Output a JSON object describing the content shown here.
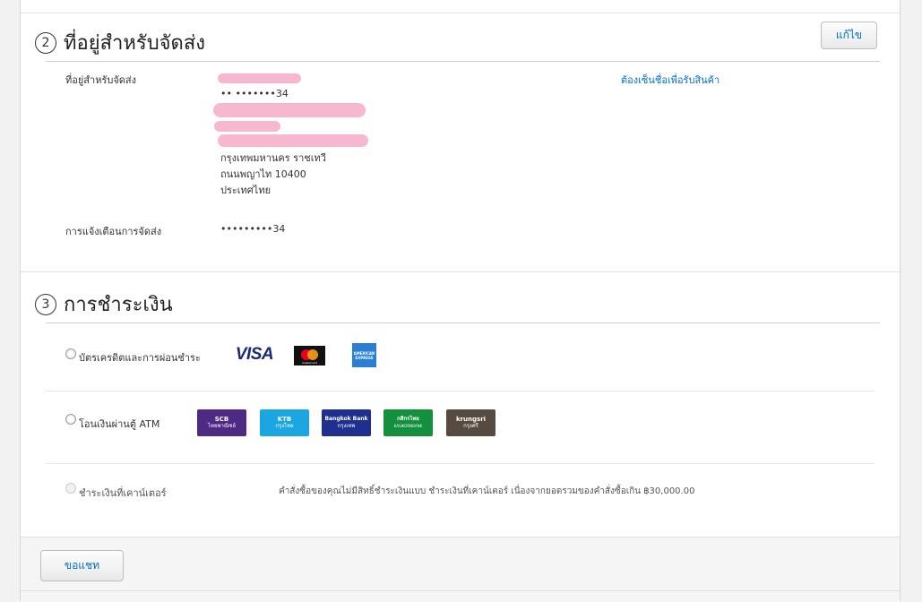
{
  "shipping": {
    "number": "2",
    "title": "ที่อยู่สำหรับจัดส่ง",
    "edit_label": "แก้ไข",
    "address_label": "ที่อยู่สำหรับจัดส่ง",
    "phone_masked": "•• •••••••34",
    "address_lines": [
      "กรุงเทพมหานคร ราชเทวี",
      "ถนนพญาไท 10400",
      "ประเทศไทย"
    ],
    "invoice_link": "ต้องเซ็นชื่อเพื่อรับสินค้า",
    "notify_label": "การแจ้งเตือนการจัดส่ง",
    "notify_value": "•••••••••34"
  },
  "payment": {
    "number": "3",
    "title": "การชำระเงิน",
    "options": [
      {
        "label": "บัตรเครดิตและการผ่อนชำระ"
      },
      {
        "label": "โอนเงินผ่านตู้ ATM"
      },
      {
        "label": "ชำระเงินที่เคาน์เตอร์"
      }
    ],
    "cards": {
      "visa": "VISA",
      "mastercard": "mastercard",
      "amex": "AMERICAN EXPRESS"
    },
    "banks": [
      {
        "name": "SCB",
        "sub": "ไทยพาณิชย์",
        "color": "#4e2a84"
      },
      {
        "name": "KTB",
        "sub": "กรุงไทย",
        "color": "#1ba5e1"
      },
      {
        "name": "Bangkok Bank",
        "sub": "กรุงเทพ",
        "color": "#1e2f8f"
      },
      {
        "name": "กสิกรไทย",
        "sub": "KASIKORNBANK",
        "color": "#138f3e"
      },
      {
        "name": "krungsri",
        "sub": "กรุงศรี",
        "color": "#574b41"
      }
    ],
    "counter_note": "คำสั่งซื้อของคุณไม่มีสิทธิ์ชำระเงินแบบ ชำระเงินที่เคาน์เตอร์ เนื่องจากยอดรวมของคำสั่งซื้อเกิน ฿30,000.00"
  },
  "footer": {
    "chat_label": "ขอแชท"
  }
}
